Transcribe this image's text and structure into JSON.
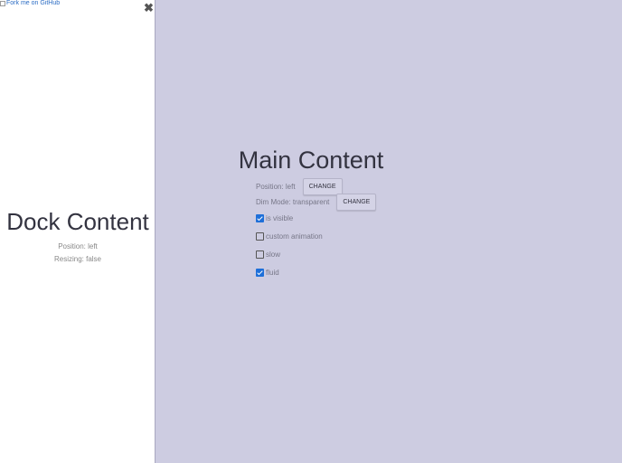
{
  "dock": {
    "fork_link_alt": "Fork me on GitHub",
    "close_glyph": "✖",
    "title": "Dock Content",
    "position_text": "Position: left",
    "resizing_text": "Resizing: false"
  },
  "main": {
    "title": "Main Content",
    "position_text": "Position: left",
    "position_button": "CHANGE",
    "dim_mode_text": "Dim Mode: transparent",
    "dim_mode_button": "CHANGE",
    "options": [
      {
        "label": "is visible",
        "checked": true
      },
      {
        "label": "custom animation",
        "checked": false
      },
      {
        "label": "slow",
        "checked": false
      },
      {
        "label": "fluid",
        "checked": true
      }
    ]
  },
  "colors": {
    "main_bg": "#cdcce1",
    "dock_bg": "#ffffff",
    "checkbox_accent": "#1e6fd9"
  }
}
